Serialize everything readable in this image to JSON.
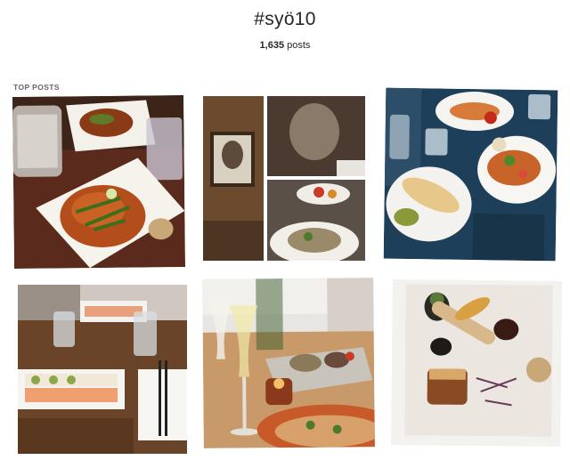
{
  "header": {
    "hashtag": "#syö10",
    "post_count_number": "1,635",
    "post_count_word": "posts"
  },
  "sections": {
    "top_posts_label": "TOP POSTS"
  }
}
